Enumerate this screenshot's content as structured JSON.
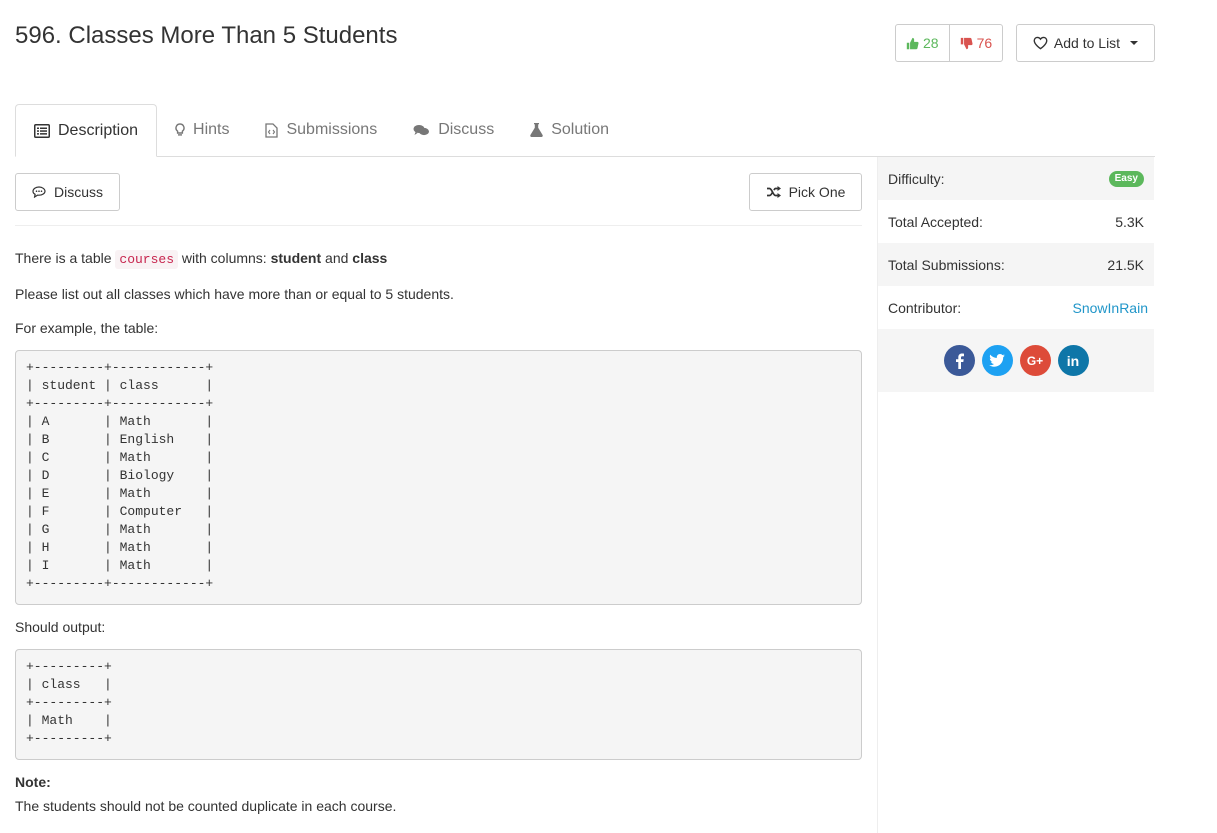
{
  "problem": {
    "title": "596. Classes More Than 5 Students"
  },
  "votes": {
    "up": "28",
    "down": "76"
  },
  "add_to_list": {
    "label": "Add to List"
  },
  "tabs": [
    {
      "label": "Description"
    },
    {
      "label": "Hints"
    },
    {
      "label": "Submissions"
    },
    {
      "label": "Discuss"
    },
    {
      "label": "Solution"
    }
  ],
  "toolbar": {
    "discuss_label": "Discuss",
    "pick_one_label": "Pick One"
  },
  "description": {
    "line1_pre": "There is a table ",
    "line1_code": "courses",
    "line1_mid": " with columns: ",
    "line1_bold1": "student",
    "line1_and": " and ",
    "line1_bold2": "class",
    "line2": "Please list out all classes which have more than or equal to 5 students.",
    "line3": "For example, the table:",
    "table_block": "+---------+------------+\n| student | class      |\n+---------+------------+\n| A       | Math       |\n| B       | English    |\n| C       | Math       |\n| D       | Biology    |\n| E       | Math       |\n| F       | Computer   |\n| G       | Math       |\n| H       | Math       |\n| I       | Math       |\n+---------+------------+",
    "output_label": "Should output:",
    "output_block": "+---------+\n| class   |\n+---------+\n| Math    |\n+---------+",
    "note_label": "Note:",
    "note_text": "The students should not be counted duplicate in each course."
  },
  "sidebar": {
    "difficulty_label": "Difficulty:",
    "difficulty_value": "Easy",
    "accepted_label": "Total Accepted:",
    "accepted_value": "5.3K",
    "submissions_label": "Total Submissions:",
    "submissions_value": "21.5K",
    "contributor_label": "Contributor:",
    "contributor_value": "SnowInRain"
  },
  "social": [
    {
      "icon": "facebook-icon",
      "glyph": "f",
      "color": "#3b5998"
    },
    {
      "icon": "twitter-icon",
      "glyph": "t",
      "color": "#1da1f2"
    },
    {
      "icon": "google-plus-icon",
      "glyph": "G+",
      "color": "#dd4b39"
    },
    {
      "icon": "linkedin-icon",
      "glyph": "in",
      "color": "#0e76a8"
    }
  ],
  "colors": {
    "easy": "#5cb85c",
    "upvote": "#5cb85c",
    "downvote": "#d9534f",
    "link": "#2196c9"
  }
}
